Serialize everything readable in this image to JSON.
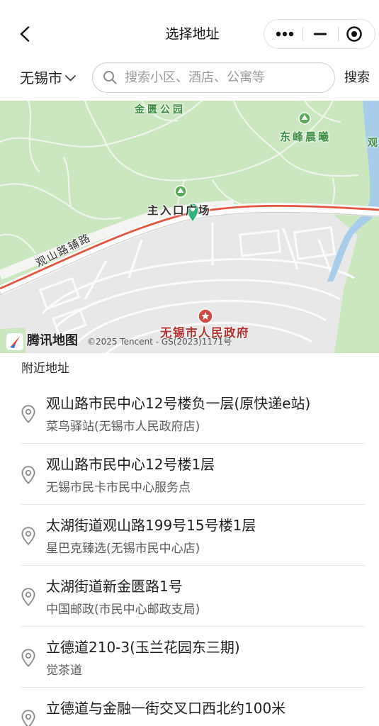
{
  "header": {
    "title": "选择地址",
    "back_icon": "back-chevron-icon",
    "capsule_icons": [
      "more-dots-icon",
      "minimize-icon",
      "target-circle-icon"
    ]
  },
  "search_bar": {
    "city": "无锡市",
    "city_icon": "chevron-down-icon",
    "search_icon": "magnifier-icon",
    "placeholder": "搜索小区、酒店、公寓等",
    "value": "",
    "button_label": "搜索"
  },
  "map": {
    "labels": {
      "park": "金匮公园",
      "residential": "东峰晨曦",
      "plaza": "主入口广场",
      "road": "观山路辅路",
      "government": "无锡市人民政府",
      "partial_right": "观"
    },
    "marker_icon": "location-pin-icon",
    "poi_icons": [
      "park-icon",
      "government-star-icon"
    ],
    "provider": "腾讯地图",
    "copyright": "©2025 Tencent - GS(2023)1171号"
  },
  "nearby": {
    "heading": "附近地址",
    "item_icon": "location-outline-icon",
    "items": [
      {
        "title": "观山路市民中心12号楼负一层(原快递e站)",
        "subtitle": "菜鸟驿站(无锡市人民政府店)"
      },
      {
        "title": "观山路市民中心12号楼1层",
        "subtitle": "无锡市民卡市民中心服务点"
      },
      {
        "title": "太湖街道观山路199号15号楼1层",
        "subtitle": "星巴克臻选(无锡市民中心店)"
      },
      {
        "title": "太湖街道新金匮路1号",
        "subtitle": "中国邮政(市民中心邮政支局)"
      },
      {
        "title": "立德道210-3(玉兰花园东三期)",
        "subtitle": "觉茶道"
      },
      {
        "title": "立德道与金融一街交叉口西北约100米"
      }
    ]
  },
  "colors": {
    "marker_green": "#2fb37a",
    "route_red": "#e4553f",
    "park_green": "#cbe7bf",
    "water_blue": "#a8cdeb",
    "poi_red": "#b8312f"
  }
}
